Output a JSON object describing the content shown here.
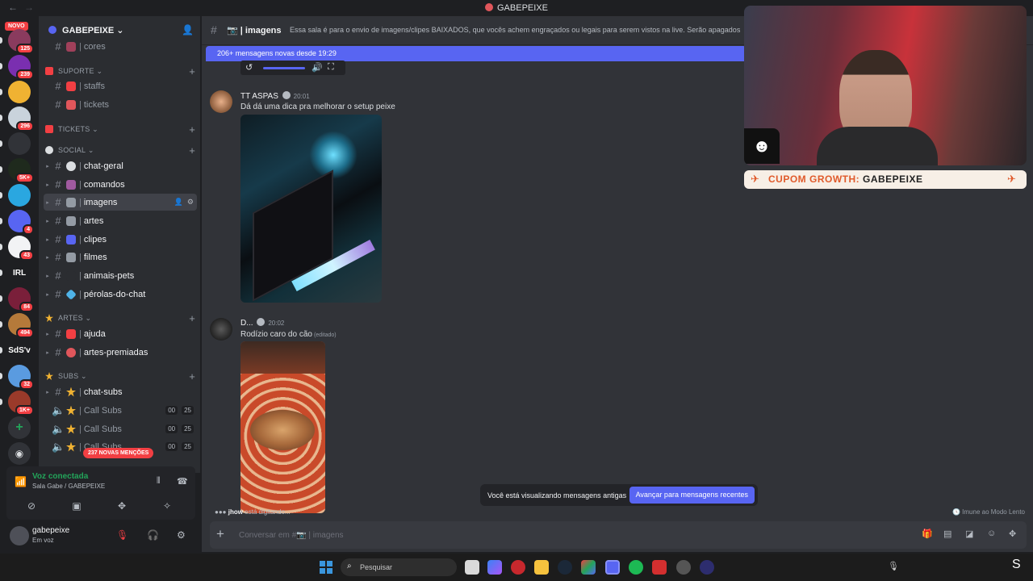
{
  "window": {
    "title": "GABEPEIXE"
  },
  "rail": {
    "novo_label": "NOVO",
    "servers": [
      {
        "badge": "125",
        "color": "#8a3b5e"
      },
      {
        "badge": "239",
        "color": "#7a2fb0"
      },
      {
        "badge": "",
        "color": "#f0b232"
      },
      {
        "badge": "296",
        "color": "#c9d3dc"
      },
      {
        "badge": "",
        "color": "#313338"
      },
      {
        "badge": "5K+",
        "color": "#1f2a1d"
      },
      {
        "badge": "",
        "color": "#2aa7e0"
      },
      {
        "badge": "4",
        "color": "#5865f2"
      },
      {
        "badge": "43",
        "color": "#f2f3f5"
      },
      {
        "badge": "",
        "color": "#1e1f22",
        "text": "IRL"
      },
      {
        "badge": "84",
        "color": "#7a1f3a"
      },
      {
        "badge": "494",
        "color": "#b57a3a"
      },
      {
        "badge": "",
        "color": "#1e1f22",
        "text": "SdS'v"
      },
      {
        "badge": "32",
        "color": "#5a9be0"
      },
      {
        "badge": "1K+",
        "color": "#9a3a2a"
      }
    ]
  },
  "guild": {
    "name": "GABEPEIXE"
  },
  "categories": {
    "suporte": "SUPORTE",
    "tickets": "TICKETS",
    "social": "SOCIAL",
    "artes": "ARTES",
    "subs": "SUBS"
  },
  "channels": {
    "cores": "cores",
    "staffs": "staffs",
    "tickets": "tickets",
    "chat_geral": "chat-geral",
    "comandos": "comandos",
    "imagens": "imagens",
    "artes": "artes",
    "clipes": "clipes",
    "filmes": "filmes",
    "animais_pets": "animais-pets",
    "perolas": "pérolas-do-chat",
    "ajuda": "ajuda",
    "artes_premiadas": "artes-premiadas",
    "chat_subs": "chat-subs",
    "call_subs_1": "Call Subs",
    "call_subs_2": "Call Subs",
    "call_subs_3": "Call Subs",
    "call_count_a": "00",
    "call_count_b": "25"
  },
  "mentions_pill": "237 NOVAS MENÇÕES",
  "voice": {
    "status": "Voz conectada",
    "location": "Sala Gabe / GABEPEIXE"
  },
  "user": {
    "name": "gabepeixe",
    "status": "Em voz"
  },
  "chat": {
    "channel_name": "imagens",
    "topic": "Essa sala é para o envio de imagens/clipes BAIXADOS, que vocês achem engraçados ou legais para serem vistos na live. Serão apagados print",
    "new_messages_banner": "206+ mensagens novas desde 19:29",
    "messages": [
      {
        "author": "TT ASPAS",
        "time": "20:01",
        "text": "Dá dá uma dica pra melhorar o setup peixe"
      },
      {
        "author": "D...",
        "time": "20:02",
        "text": "Rodízio caro do cão",
        "edited": "(editado)"
      }
    ],
    "old_messages_notice": "Você está visualizando mensagens antigas",
    "jump_button": "Avançar para mensagens recentes",
    "typing_user": "jhow",
    "typing_suffix": "está digitando...",
    "slowmode": "Imune ao Modo Lento",
    "composer_placeholder": "Conversar em #📷 | imagens"
  },
  "overlay": {
    "coupon_label": "CUPOM GROWTH:",
    "coupon_code": "GABEPEIXE"
  },
  "taskbar": {
    "search_placeholder": "Pesquisar"
  }
}
